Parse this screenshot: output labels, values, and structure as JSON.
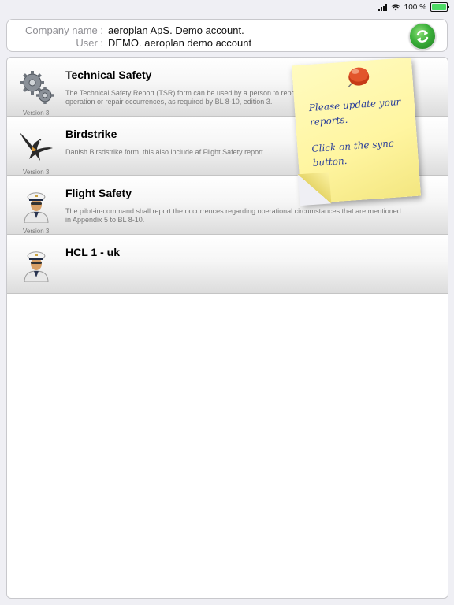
{
  "status_bar": {
    "battery_text": "100 %"
  },
  "header": {
    "company_label": "Company name :",
    "company_value": "aeroplan ApS.  Demo account.",
    "user_label": "User :",
    "user_value": "DEMO. aeroplan demo account"
  },
  "reports": [
    {
      "title": "Technical Safety",
      "description": "The Technical Safety Report (TSR) form can be used by a person to report occurrences related to the operation or repair occurrences, as required by BL 8-10, edition 3.",
      "version": "Version 3",
      "icon": "gears-icon"
    },
    {
      "title": "Birdstrike",
      "description": "Danish Birsdstrike form, this also include af Flight Safety report.",
      "version": "Version 3",
      "icon": "swallow-icon"
    },
    {
      "title": "Flight Safety",
      "description": "The pilot-in-command shall report the occurrences regarding operational circumstances that are mentioned in Appendix 5 to BL 8-10.",
      "version": "Version 3",
      "icon": "pilot-icon"
    },
    {
      "title": "HCL 1 - uk",
      "description": "",
      "version": "",
      "icon": "pilot-icon"
    }
  ],
  "sticky_note": {
    "line1": "Please update your reports.",
    "line2": "Click on the sync button."
  },
  "colors": {
    "sync_green": "#3bb03a",
    "note_yellow": "#fff5a0",
    "note_ink": "#2b3f9a",
    "pin_red": "#d9451f"
  }
}
